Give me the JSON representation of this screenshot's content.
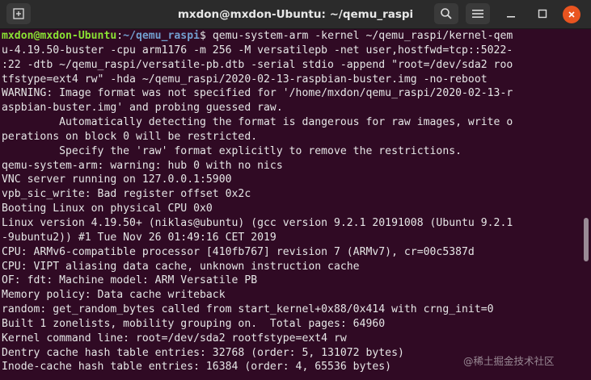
{
  "window": {
    "title": "mxdon@mxdon-Ubuntu: ~/qemu_raspi"
  },
  "colors": {
    "background": "#300a24",
    "titlebar": "#2b2b2b",
    "text": "#e6e6e6",
    "prompt_user": "#8ae234",
    "prompt_path": "#729fcf",
    "close": "#e95420"
  },
  "icons": {
    "new_tab": "new-tab-icon",
    "search": "search-icon",
    "menu": "hamburger-menu-icon",
    "minimize": "minimize-icon",
    "maximize": "maximize-icon",
    "close": "close-icon"
  },
  "terminal": {
    "prompt_user": "mxdon@mxdon-Ubuntu",
    "prompt_sep": ":",
    "prompt_path": "~/qemu_raspi",
    "prompt_symbol": "$ ",
    "command_first": "qemu-system-arm -kernel ~/qemu_raspi/kernel-qem",
    "lines": [
      "u-4.19.50-buster -cpu arm1176 -m 256 -M versatilepb -net user,hostfwd=tcp::5022-",
      ":22 -dtb ~/qemu_raspi/versatile-pb.dtb -serial stdio -append \"root=/dev/sda2 roo",
      "tfstype=ext4 rw\" -hda ~/qemu_raspi/2020-02-13-raspbian-buster.img -no-reboot",
      "WARNING: Image format was not specified for '/home/mxdon/qemu_raspi/2020-02-13-r",
      "aspbian-buster.img' and probing guessed raw.",
      "         Automatically detecting the format is dangerous for raw images, write o",
      "perations on block 0 will be restricted.",
      "         Specify the 'raw' format explicitly to remove the restrictions.",
      "qemu-system-arm: warning: hub 0 with no nics",
      "VNC server running on 127.0.0.1:5900",
      "vpb_sic_write: Bad register offset 0x2c",
      "Booting Linux on physical CPU 0x0",
      "Linux version 4.19.50+ (niklas@ubuntu) (gcc version 9.2.1 20191008 (Ubuntu 9.2.1",
      "-9ubuntu2)) #1 Tue Nov 26 01:49:16 CET 2019",
      "CPU: ARMv6-compatible processor [410fb767] revision 7 (ARMv7), cr=00c5387d",
      "CPU: VIPT aliasing data cache, unknown instruction cache",
      "OF: fdt: Machine model: ARM Versatile PB",
      "Memory policy: Data cache writeback",
      "random: get_random_bytes called from start_kernel+0x88/0x414 with crng_init=0",
      "Built 1 zonelists, mobility grouping on.  Total pages: 64960",
      "Kernel command line: root=/dev/sda2 rootfstype=ext4 rw",
      "Dentry cache hash table entries: 32768 (order: 5, 131072 bytes)",
      "Inode-cache hash table entries: 16384 (order: 4, 65536 bytes)"
    ]
  },
  "watermark": {
    "text": "@稀土掘金技术社区"
  }
}
